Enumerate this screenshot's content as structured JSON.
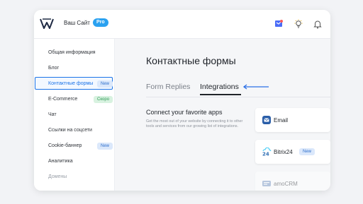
{
  "header": {
    "site_name": "Ваш Сайт",
    "pro_badge": "Pro"
  },
  "sidebar": {
    "items": [
      {
        "label": "Общая информация"
      },
      {
        "label": "Блог"
      },
      {
        "label": "Контактные формы",
        "badge": "New",
        "active": true
      },
      {
        "label": "E-Commerce",
        "badge": "Скоро"
      },
      {
        "label": "Чат"
      },
      {
        "label": "Ссылки на соцсети"
      },
      {
        "label": "Cookie-баннер",
        "badge": "New"
      },
      {
        "label": "Аналитика"
      },
      {
        "label": "Домены"
      }
    ]
  },
  "main": {
    "title": "Контактные формы",
    "tabs": [
      {
        "label": "Form Replies"
      },
      {
        "label": "Integrations",
        "active": true
      }
    ],
    "connect_title": "Connect your favorite apps",
    "connect_desc": "Get the most out of your website by connecting it to other tools and services from our growing list of integrations.",
    "integrations": [
      {
        "name": "Email",
        "icon": "email-icon"
      },
      {
        "name": "Bitrix24",
        "badge": "New",
        "icon": "bitrix24-icon"
      },
      {
        "name": "amoCRM",
        "icon": "amocrm-icon"
      }
    ]
  },
  "colors": {
    "accent": "#1a73e8",
    "pro_badge": "#2aa1f0",
    "new_badge_bg": "#dbe8fb",
    "soon_badge_bg": "#d8f2e0"
  }
}
